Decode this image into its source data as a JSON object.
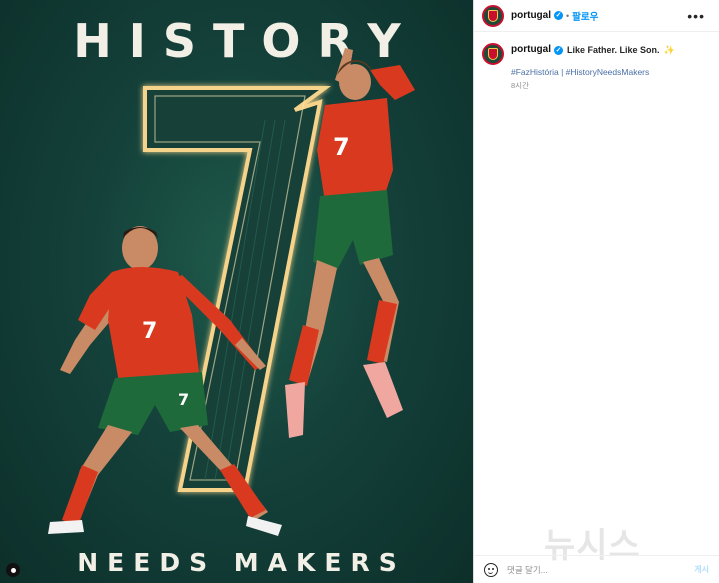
{
  "poster": {
    "title": "HISTORY",
    "subtitle": "NEEDS MAKERS",
    "big_number": "7",
    "left_shirt_number": "7",
    "left_shorts_number": "7",
    "right_shirt_number": "7"
  },
  "header": {
    "username": "portugal",
    "separator": "•",
    "follow_label": "팔로우",
    "more_label": "•••"
  },
  "caption": {
    "username": "portugal",
    "text": "Like Father. Like Son.",
    "sparkle": "✨",
    "hashtags": "#FazHistória | #HistoryNeedsMakers",
    "time": "8시간"
  },
  "watermark": "뉴시스",
  "comment": {
    "placeholder": "댓글 달기...",
    "post_label": "게시"
  },
  "colors": {
    "poster_bg": "#14413a",
    "neon": "#f6d38a",
    "shirt_red": "#d93a1f",
    "shorts_green": "#1f6a3a",
    "link_blue": "#0095f6"
  }
}
